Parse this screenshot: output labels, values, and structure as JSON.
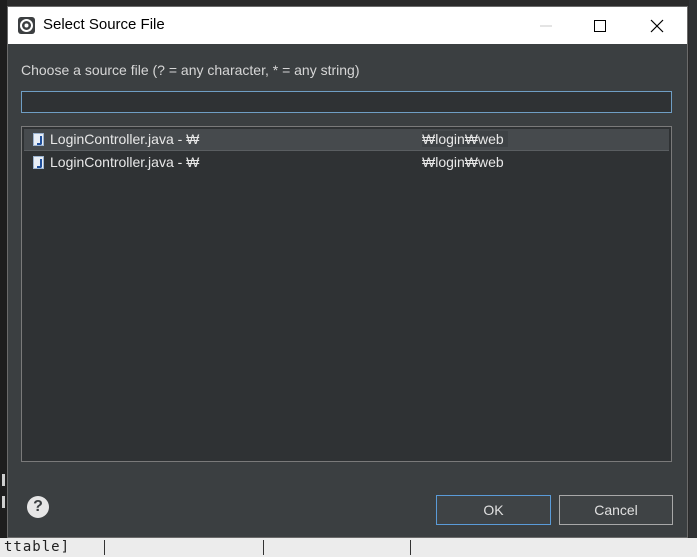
{
  "dialog": {
    "title": "Select Source File",
    "prompt": "Choose a source file (? = any character, * = any string)",
    "filter": {
      "value": "",
      "placeholder": ""
    },
    "results": [
      {
        "name": "LoginController.java - ₩",
        "path": "₩login₩web",
        "selected": true,
        "icon": "java-file-icon"
      },
      {
        "name": "LoginController.java - ₩",
        "path": "₩login₩web",
        "selected": false,
        "icon": "java-file-icon"
      }
    ],
    "buttons": {
      "ok": "OK",
      "cancel": "Cancel"
    },
    "help_icon": "question-icon"
  },
  "background": {
    "code_fragment": "ttable]"
  },
  "colors": {
    "dialog_bg": "#3b3f41",
    "list_bg": "#2f3234",
    "accent": "#5a9bd8"
  }
}
